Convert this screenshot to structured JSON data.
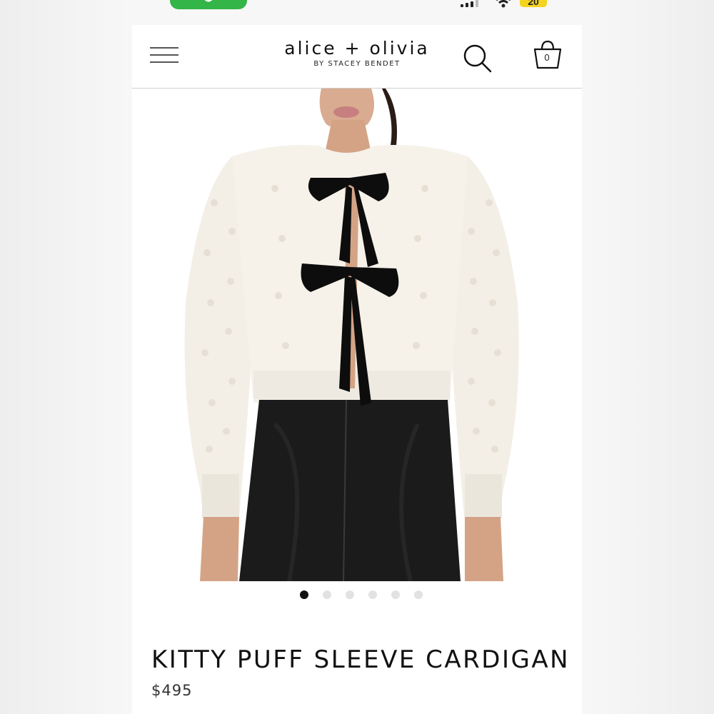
{
  "status_bar": {
    "battery_level": "20",
    "call_active_color": "#34b547",
    "battery_color": "#f4d41f"
  },
  "header": {
    "brand_name": "alice + olivia",
    "brand_subtitle": "BY STACEY BENDET",
    "menu_icon": "hamburger-icon",
    "search_icon": "search-icon",
    "bag_icon": "shopping-bag-icon",
    "bag_count": "0"
  },
  "carousel": {
    "total_slides": 6,
    "active_slide": 1
  },
  "product": {
    "title": "KITTY PUFF SLEEVE CARDIGAN",
    "price": "$495"
  }
}
